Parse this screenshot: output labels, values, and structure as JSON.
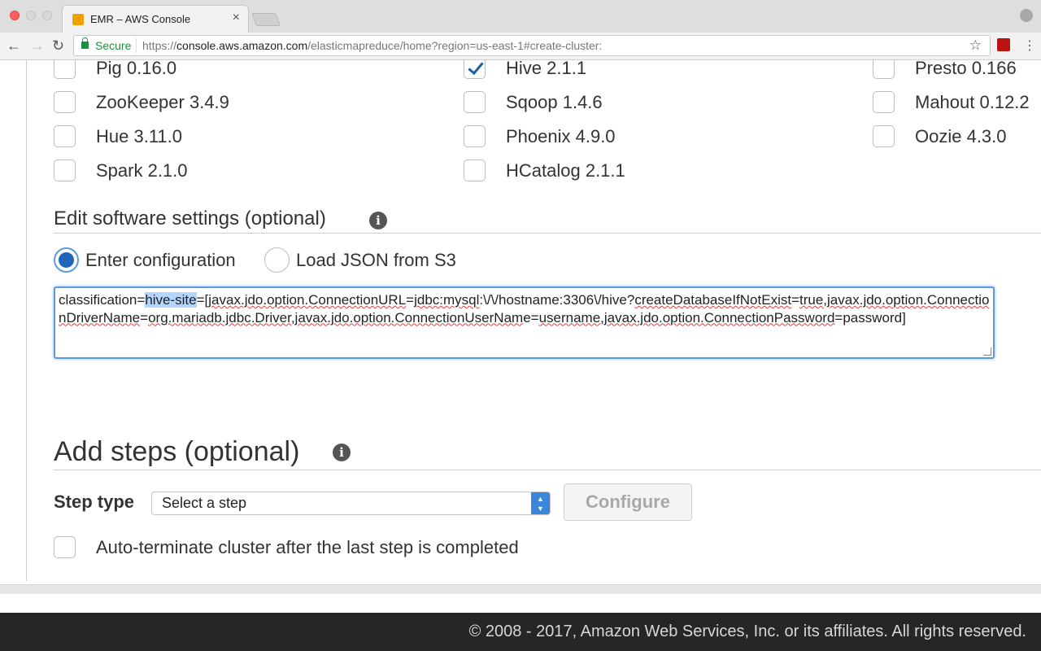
{
  "browser": {
    "tab_title": "EMR – AWS Console",
    "tab_close": "×",
    "secure_label": "Secure",
    "url_scheme": "https://",
    "url_host": "console.aws.amazon.com",
    "url_path": "/elasticmapreduce/home?region=us-east-1#create-cluster:",
    "icons": {
      "back": "←",
      "forward": "→",
      "reload": "↻",
      "star": "☆",
      "menu": "⋮"
    }
  },
  "applications": [
    {
      "label": "Pig 0.16.0",
      "checked": false
    },
    {
      "label": "Hive 2.1.1",
      "checked": true
    },
    {
      "label": "Presto 0.166",
      "checked": false
    },
    {
      "label": "ZooKeeper 3.4.9",
      "checked": false
    },
    {
      "label": "Sqoop 1.4.6",
      "checked": false
    },
    {
      "label": "Mahout 0.12.2",
      "checked": false
    },
    {
      "label": "Hue 3.11.0",
      "checked": false
    },
    {
      "label": "Phoenix 4.9.0",
      "checked": false
    },
    {
      "label": "Oozie 4.3.0",
      "checked": false
    },
    {
      "label": "Spark 2.1.0",
      "checked": false
    },
    {
      "label": "HCatalog 2.1.1",
      "checked": false
    }
  ],
  "software_settings": {
    "title": "Edit software settings (optional)",
    "info": "i",
    "option_enter": "Enter configuration",
    "option_load": "Load JSON from S3",
    "selected": "Enter configuration",
    "config": {
      "p1": "classification=",
      "p2": "hive-site",
      "p3": "=[",
      "p4": "javax.jdo.option.ConnectionURL",
      "p5": "=",
      "p6": "jdbc:mysql",
      "p7": ":\\/\\/hostname:3306\\/hive?",
      "p8": "createDatabaseIfNotExist",
      "p9": "=",
      "p10": "true,javax.jdo.option.ConnectionDriverName",
      "p11": "=",
      "p12": "org.mariadb.jdbc.Driver,javax.jdo.option.ConnectionUserNam",
      "p13": "e=",
      "p14": "username,javax.jdo.option.ConnectionPassword",
      "p15": "=password]"
    }
  },
  "steps": {
    "title": "Add steps (optional)",
    "info": "i",
    "step_type_label": "Step type",
    "step_select_value": "Select a step",
    "configure_label": "Configure",
    "autoterminate_label": "Auto-terminate cluster after the last step is completed",
    "autoterminate_checked": false
  },
  "footer": {
    "text": "© 2008 - 2017, Amazon Web Services, Inc. or its affiliates. All rights reserved."
  },
  "colors": {
    "accent": "#1f66b8",
    "focus_border": "#5a9be0",
    "footer_bg": "#262626"
  }
}
